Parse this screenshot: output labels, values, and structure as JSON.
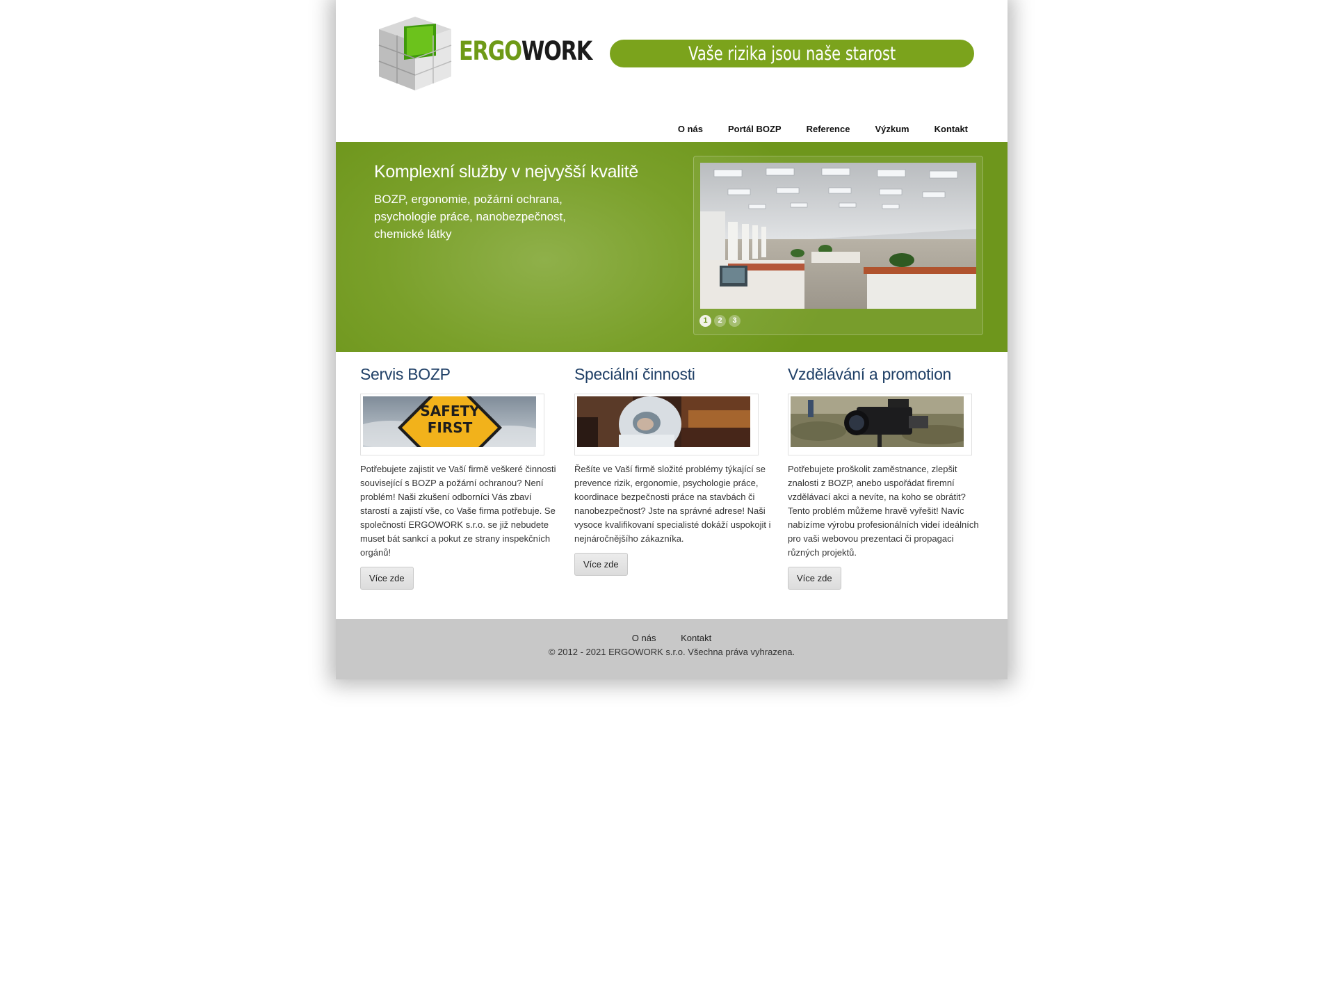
{
  "header": {
    "logo_ergo": "ERGO",
    "logo_work": "WORK",
    "slogan": "Vaše rizika jsou naše starost"
  },
  "nav": {
    "items": [
      "O nás",
      "Portál BOZP",
      "Reference",
      "Výzkum",
      "Kontakt"
    ]
  },
  "hero": {
    "title": "Komplexní služby v nejvyšší kvalitě",
    "subtitle": "BOZP, ergonomie, požární ochrana, psychologie práce, nanobezpečnost, chemické látky",
    "dots": [
      "1",
      "2",
      "3"
    ],
    "active_dot": 1
  },
  "columns": [
    {
      "title": "Servis BOZP",
      "sign_line1": "SAFETY",
      "sign_line2": "FIRST",
      "text": "Potřebujete zajistit ve Vaší firmě veškeré činnosti související s BOZP a požární ochranou? Není problém! Naši zkušení odborníci Vás zbaví starostí a zajistí vše, co Vaše firma potřebuje. Se společností ERGOWORK s.r.o. se již nebudete muset bát sankcí a pokut ze strany inspekčních orgánů!",
      "button": "Více zde"
    },
    {
      "title": "Speciální činnosti",
      "text": "Řešíte ve Vaší firmě složité problémy týkající se prevence rizik, ergonomie, psychologie práce, koordinace bezpečnosti práce na stavbách či nanobezpečnost? Jste na správné adrese! Naši vysoce kvalifikovaní specialisté dokáží uspokojit i nejnáročnějšího zákazníka.",
      "button": "Více zde"
    },
    {
      "title": "Vzdělávání a promotion",
      "text": "Potřebujete proškolit zaměstnance, zlepšit znalosti z BOZP, anebo uspořádat firemní vzdělávací akci a nevíte, na koho se obrátit? Tento problém můžeme hravě vyřešit! Navíc nabízíme výrobu profesionálních videí ideálních pro vaši webovou prezentaci či propagaci různých projektů.",
      "button": "Více zde"
    }
  ],
  "footer": {
    "links": [
      "O nás",
      "Kontakt"
    ],
    "copyright": "© 2012 - 2021 ERGOWORK s.r.o. Všechna práva vyhrazena."
  },
  "colors": {
    "brand_green": "#7ba31c",
    "heading_blue": "#1f3f66",
    "footer_gray": "#c8c8c8"
  }
}
